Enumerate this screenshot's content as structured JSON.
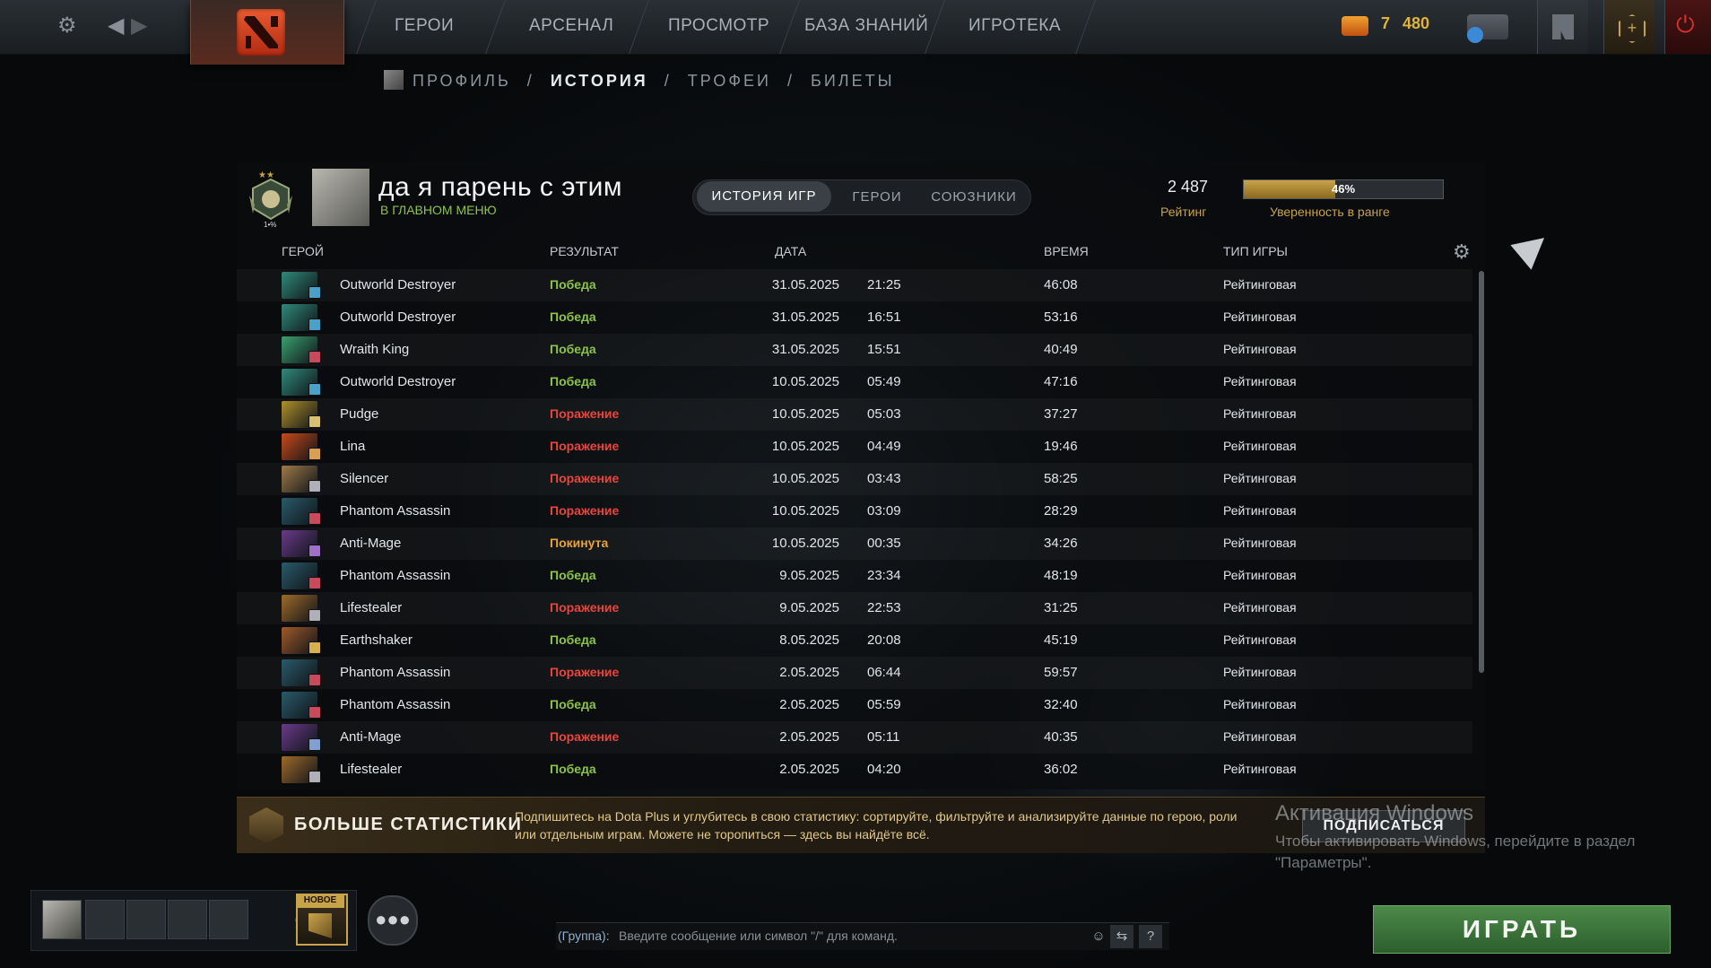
{
  "topbar": {
    "nav": [
      "ГЕРОИ",
      "АРСЕНАЛ",
      "ПРОСМОТР",
      "БАЗА ЗНАНИЙ",
      "ИГРОТЕКА"
    ],
    "shards_a": "7",
    "shards_b": "480",
    "icons": {
      "settings": "gear-icon",
      "back": "arrow-left-icon",
      "forward": "arrow-right-icon",
      "logo": "dota-logo-icon",
      "chat": "chat-icon",
      "armory": "armory-icon",
      "plus": "dota-plus-icon",
      "power": "power-icon"
    }
  },
  "breadcrumb": {
    "items": [
      "ПРОФИЛЬ",
      "ИСТОРИЯ",
      "ТРОФЕИ",
      "БИЛЕТЫ"
    ],
    "active_index": 1,
    "separator": "/"
  },
  "profile": {
    "name": "да я парень с этим",
    "status": "В ГЛАВНОМ МЕНЮ",
    "medal_label": "1•%",
    "rating_value": "2 487",
    "rating_label": "Рейтинг",
    "confidence_text": "46%",
    "confidence_value": 0.46,
    "confidence_label": "Уверенность в ранге"
  },
  "tabs": [
    "ИСТОРИЯ ИГР",
    "ГЕРОИ",
    "СОЮЗНИКИ"
  ],
  "columns": {
    "hero": "ГЕРОЙ",
    "result": "РЕЗУЛЬТАТ",
    "date": "ДАТА",
    "duration": "ВРЕМЯ",
    "mode": "ТИП ИГРЫ"
  },
  "matches": [
    {
      "hero": "Outworld Destroyer",
      "result": "Победа",
      "outcome": "win",
      "date": "31.05.2025",
      "time": "21:25",
      "duration": "46:08",
      "mode": "Рейтинговая",
      "hero_color": "#2f8a7a",
      "role_color": "#4aa0c8"
    },
    {
      "hero": "Outworld Destroyer",
      "result": "Победа",
      "outcome": "win",
      "date": "31.05.2025",
      "time": "16:51",
      "duration": "53:16",
      "mode": "Рейтинговая",
      "hero_color": "#2f8a7a",
      "role_color": "#4aa0c8"
    },
    {
      "hero": "Wraith King",
      "result": "Победа",
      "outcome": "win",
      "date": "31.05.2025",
      "time": "15:51",
      "duration": "40:49",
      "mode": "Рейтинговая",
      "hero_color": "#3aa070",
      "role_color": "#c84a5a"
    },
    {
      "hero": "Outworld Destroyer",
      "result": "Победа",
      "outcome": "win",
      "date": "10.05.2025",
      "time": "05:49",
      "duration": "47:16",
      "mode": "Рейтинговая",
      "hero_color": "#2f8a7a",
      "role_color": "#4aa0c8"
    },
    {
      "hero": "Pudge",
      "result": "Поражение",
      "outcome": "loss",
      "date": "10.05.2025",
      "time": "05:03",
      "duration": "37:27",
      "mode": "Рейтинговая",
      "hero_color": "#b0902a",
      "role_color": "#d8c070"
    },
    {
      "hero": "Lina",
      "result": "Поражение",
      "outcome": "loss",
      "date": "10.05.2025",
      "time": "04:49",
      "duration": "19:46",
      "mode": "Рейтинговая",
      "hero_color": "#c84a1a",
      "role_color": "#d8a050"
    },
    {
      "hero": "Silencer",
      "result": "Поражение",
      "outcome": "loss",
      "date": "10.05.2025",
      "time": "03:43",
      "duration": "58:25",
      "mode": "Рейтинговая",
      "hero_color": "#a07a4a",
      "role_color": "#b0b0b8"
    },
    {
      "hero": "Phantom Assassin",
      "result": "Поражение",
      "outcome": "loss",
      "date": "10.05.2025",
      "time": "03:09",
      "duration": "28:29",
      "mode": "Рейтинговая",
      "hero_color": "#2a5a6a",
      "role_color": "#c84a5a"
    },
    {
      "hero": "Anti-Mage",
      "result": "Покинута",
      "outcome": "abandon",
      "date": "10.05.2025",
      "time": "00:35",
      "duration": "34:26",
      "mode": "Рейтинговая",
      "hero_color": "#6a3a8a",
      "role_color": "#a070c8"
    },
    {
      "hero": "Phantom Assassin",
      "result": "Победа",
      "outcome": "win",
      "date": "9.05.2025",
      "time": "23:34",
      "duration": "48:19",
      "mode": "Рейтинговая",
      "hero_color": "#2a5a6a",
      "role_color": "#c84a5a"
    },
    {
      "hero": "Lifestealer",
      "result": "Поражение",
      "outcome": "loss",
      "date": "9.05.2025",
      "time": "22:53",
      "duration": "31:25",
      "mode": "Рейтинговая",
      "hero_color": "#a06a2a",
      "role_color": "#b0b0b8"
    },
    {
      "hero": "Earthshaker",
      "result": "Победа",
      "outcome": "win",
      "date": "8.05.2025",
      "time": "20:08",
      "duration": "45:19",
      "mode": "Рейтинговая",
      "hero_color": "#a05a2a",
      "role_color": "#d8b050"
    },
    {
      "hero": "Phantom Assassin",
      "result": "Поражение",
      "outcome": "loss",
      "date": "2.05.2025",
      "time": "06:44",
      "duration": "59:57",
      "mode": "Рейтинговая",
      "hero_color": "#2a5a6a",
      "role_color": "#c84a5a"
    },
    {
      "hero": "Phantom Assassin",
      "result": "Победа",
      "outcome": "win",
      "date": "2.05.2025",
      "time": "05:59",
      "duration": "32:40",
      "mode": "Рейтинговая",
      "hero_color": "#2a5a6a",
      "role_color": "#c84a5a"
    },
    {
      "hero": "Anti-Mage",
      "result": "Поражение",
      "outcome": "loss",
      "date": "2.05.2025",
      "time": "05:11",
      "duration": "40:35",
      "mode": "Рейтинговая",
      "hero_color": "#6a3a8a",
      "role_color": "#80a0d0"
    },
    {
      "hero": "Lifestealer",
      "result": "Победа",
      "outcome": "win",
      "date": "2.05.2025",
      "time": "04:20",
      "duration": "36:02",
      "mode": "Рейтинговая",
      "hero_color": "#a06a2a",
      "role_color": "#b0b0b8"
    }
  ],
  "colors": {
    "win": "#8bc34a",
    "loss": "#e8453c",
    "abandon": "#e8a23a",
    "accent_gold": "#c9a34a",
    "play_green": "#3c7a3a"
  },
  "promo": {
    "title": "БОЛЬШЕ СТАТИСТИКИ",
    "text": "Подпишитесь на Dota Plus и углубитесь в свою статистику: сортируйте, фильтруйте и анализируйте данные по герою, роли или отдельным играм. Можете не торопиться — здесь вы найдёте всё.",
    "button": "ПОДПИСАТЬСЯ"
  },
  "windows_activation": {
    "title": "Активация Windows",
    "text": "Чтобы активировать Windows, перейдите в раздел \"Параметры\"."
  },
  "bottom": {
    "new_badge": "НОВОЕ",
    "chat_label": "(Группа):",
    "chat_placeholder": "Введите сообщение или символ \"/\" для команд.",
    "help_button": "?",
    "play_button": "ИГРАТЬ"
  }
}
